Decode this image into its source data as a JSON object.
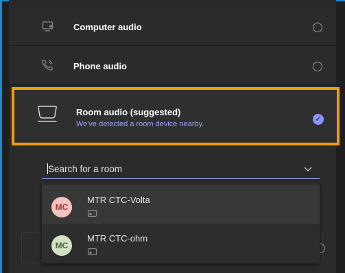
{
  "options": {
    "computer": {
      "label": "Computer audio",
      "icon": "computer-icon",
      "selected": false
    },
    "phone": {
      "label": "Phone audio",
      "icon": "phone-icon",
      "selected": false
    },
    "room": {
      "label": "Room audio (suggested)",
      "subtitle": "We've detected a room device nearby.",
      "icon": "room-device-icon",
      "selected": true
    }
  },
  "room_search": {
    "value": "Search for a room",
    "icon": "chevron-down-icon"
  },
  "rooms": [
    {
      "initials": "MC",
      "name": "MTR CTC-Volta",
      "avatar_bg": "#f4c2bf",
      "avatar_fg": "#a03a32",
      "icon": "cast-icon"
    },
    {
      "initials": "MC",
      "name": "MTR CTC-ohm",
      "avatar_bg": "#d3e2c5",
      "avatar_fg": "#3f6a2e",
      "icon": "cast-icon"
    }
  ],
  "colors": {
    "highlight_border": "#f29d0c",
    "accent": "#8b93ff",
    "frame_border": "#1c8bd0"
  }
}
